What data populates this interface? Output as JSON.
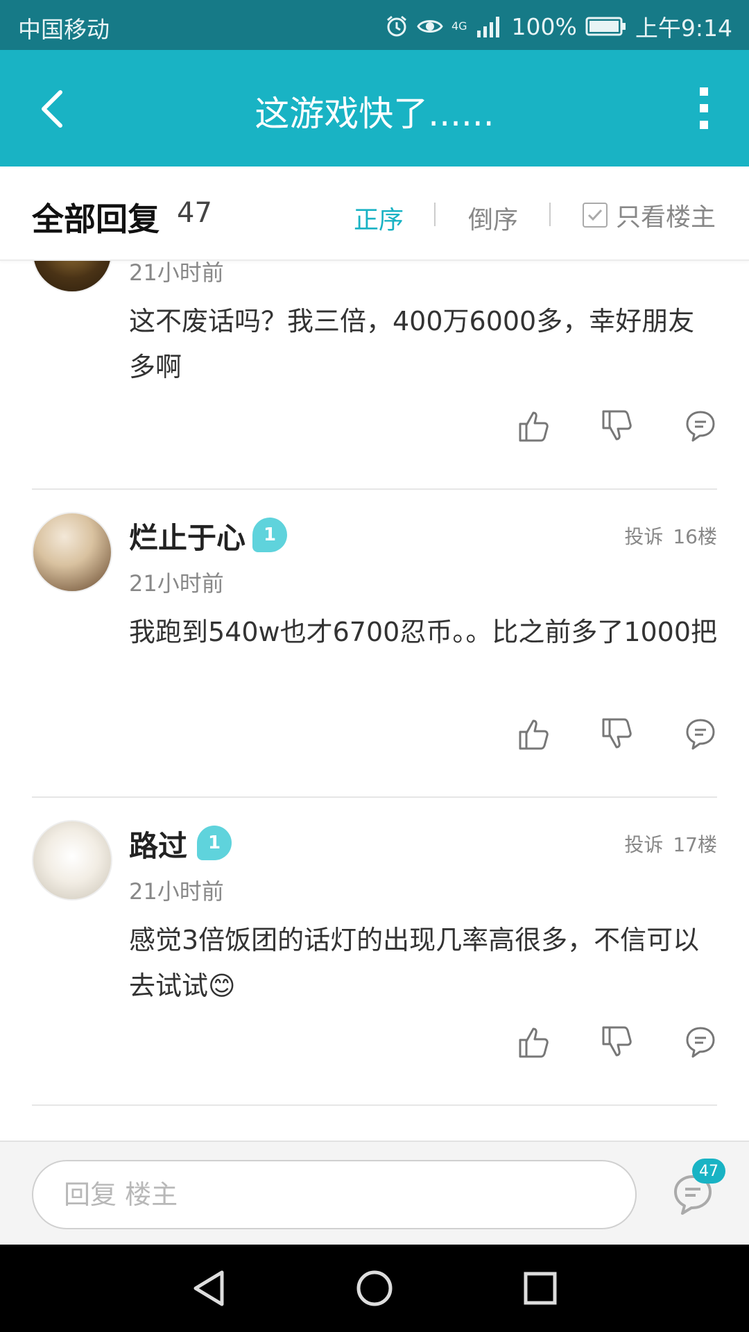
{
  "status_bar": {
    "carrier": "中国移动",
    "network": "4G",
    "battery": "100%",
    "time": "上午9:14"
  },
  "header": {
    "title": "这游戏快了......",
    "back_icon": "back-arrow-icon",
    "more_icon": "more-vertical-icon"
  },
  "reply_header": {
    "label": "全部回复",
    "count": "47",
    "sort_asc": "正序",
    "sort_desc": "倒序",
    "op_only": "只看楼主"
  },
  "posts": [
    {
      "time": "21小时前",
      "text": "这不废话吗？我三倍，400万6000多，幸好朋友多啊"
    },
    {
      "username": "烂止于心",
      "level": "1",
      "report": "投诉",
      "floor": "16楼",
      "time": "21小时前",
      "text": "我跑到540w也才6700忍币。。比之前多了1000把"
    },
    {
      "username": "路过",
      "level": "1",
      "report": "投诉",
      "floor": "17楼",
      "time": "21小时前",
      "text": "感觉3倍饭团的话灯的出现几率高很多，不信可以去试试😊"
    }
  ],
  "bottom_bar": {
    "placeholder": "回复  楼主",
    "reply_count": "47"
  },
  "colors": {
    "status_bar": "#167a87",
    "accent": "#19b3c4",
    "level_badge": "#5fd3dc"
  }
}
